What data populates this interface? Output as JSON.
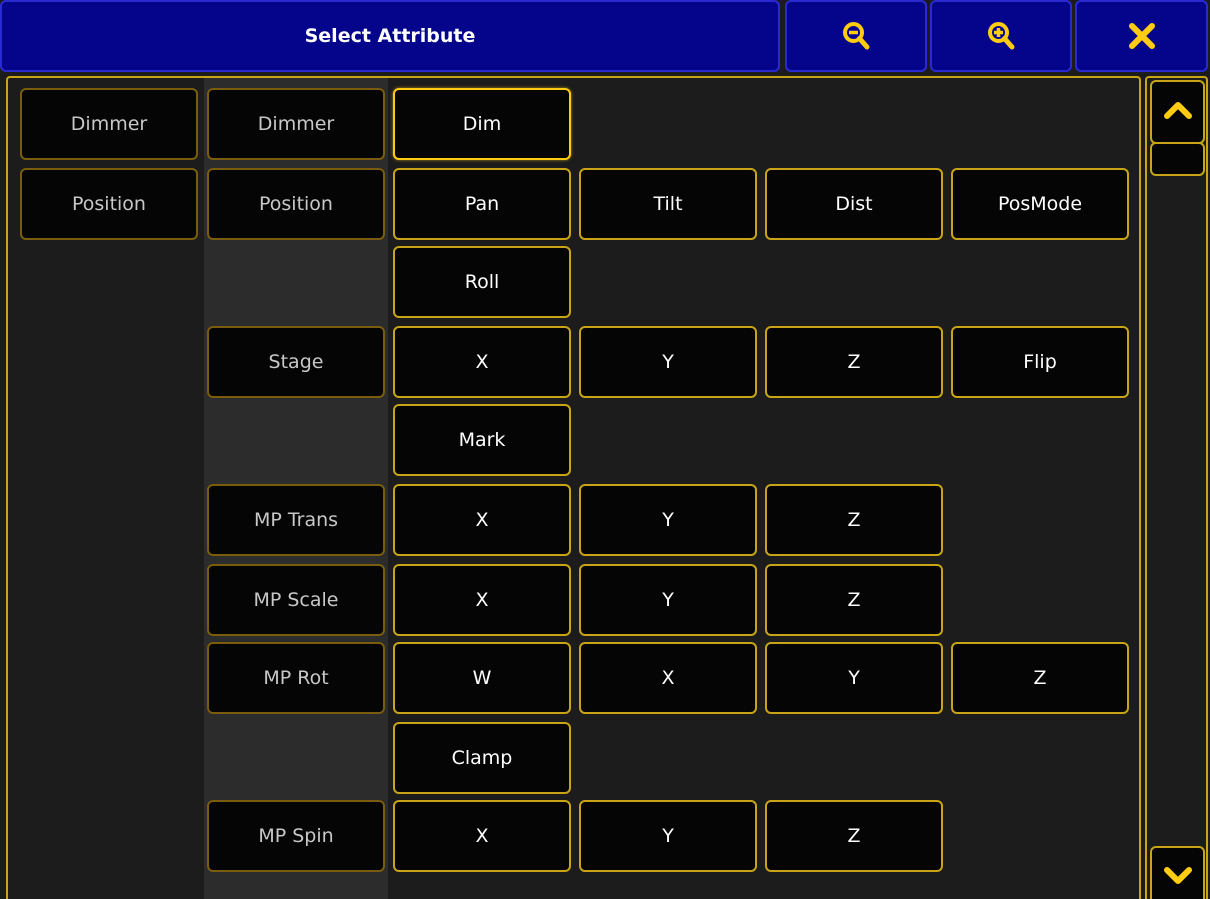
{
  "header": {
    "title": "Select Attribute",
    "zoom_out_icon": "zoom-out-icon",
    "zoom_in_icon": "zoom-in-icon",
    "close_icon": "close-icon"
  },
  "colors": {
    "title_bg": "#05058c",
    "accent": "#ffcc11",
    "button_bg": "#050505",
    "panel_bg": "#1c1c1c"
  },
  "categories": [
    "Dimmer",
    "Position"
  ],
  "feature_groups": [
    {
      "label": "Dimmer",
      "attribute_rows": [
        [
          "Dim"
        ]
      ]
    },
    {
      "label": "Position",
      "attribute_rows": [
        [
          "Pan",
          "Tilt",
          "Dist",
          "PosMode"
        ],
        [
          "Roll"
        ]
      ]
    },
    {
      "label": "Stage",
      "attribute_rows": [
        [
          "X",
          "Y",
          "Z",
          "Flip"
        ],
        [
          "Mark"
        ]
      ]
    },
    {
      "label": "MP Trans",
      "attribute_rows": [
        [
          "X",
          "Y",
          "Z"
        ]
      ]
    },
    {
      "label": "MP Scale",
      "attribute_rows": [
        [
          "X",
          "Y",
          "Z"
        ]
      ]
    },
    {
      "label": "MP Rot",
      "attribute_rows": [
        [
          "W",
          "X",
          "Y",
          "Z"
        ],
        [
          "Clamp"
        ]
      ]
    },
    {
      "label": "MP Spin",
      "attribute_rows": [
        [
          "X",
          "Y",
          "Z"
        ]
      ]
    }
  ],
  "selected_attribute": "Dim",
  "scrollbar": {
    "up_icon": "chevron-up-icon",
    "down_icon": "chevron-down-icon"
  }
}
